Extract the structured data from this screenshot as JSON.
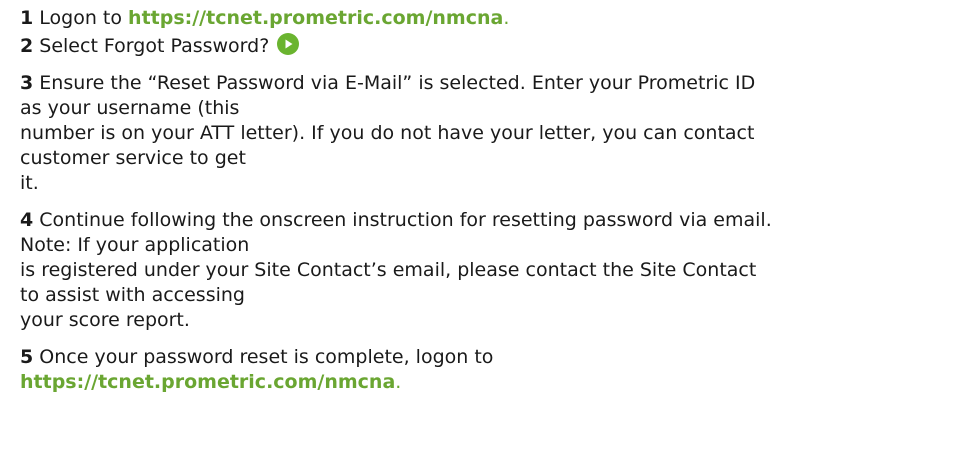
{
  "steps": [
    {
      "num": "1",
      "pre": "Logon to",
      "link": "https://tcnet.prometric.com/nmcna",
      "post": "."
    },
    {
      "num": "2",
      "text": "Select Forgot Password?",
      "icon": "play-icon"
    },
    {
      "num": "3",
      "lines": [
        "Ensure the “Reset Password via E-Mail” is selected. Enter your Prometric ID",
        "as your username (this",
        "number is on your ATT letter). If you do not have your letter, you can contact",
        "customer service to get",
        "it."
      ]
    },
    {
      "num": "4",
      "lines": [
        "Continue following the onscreen instruction for resetting password via email.",
        "Note: If your application",
        "is registered under your Site Contact’s email, please contact the Site Contact",
        "to assist with accessing",
        "your score report."
      ]
    },
    {
      "num": "5",
      "pre": "Once your password reset is complete, logon to",
      "link": "https://tcnet.prometric.com/nmcna",
      "post": "."
    }
  ],
  "colors": {
    "link": "#6aa632",
    "icon": "#6ab42f",
    "text": "#1a1a1a"
  }
}
